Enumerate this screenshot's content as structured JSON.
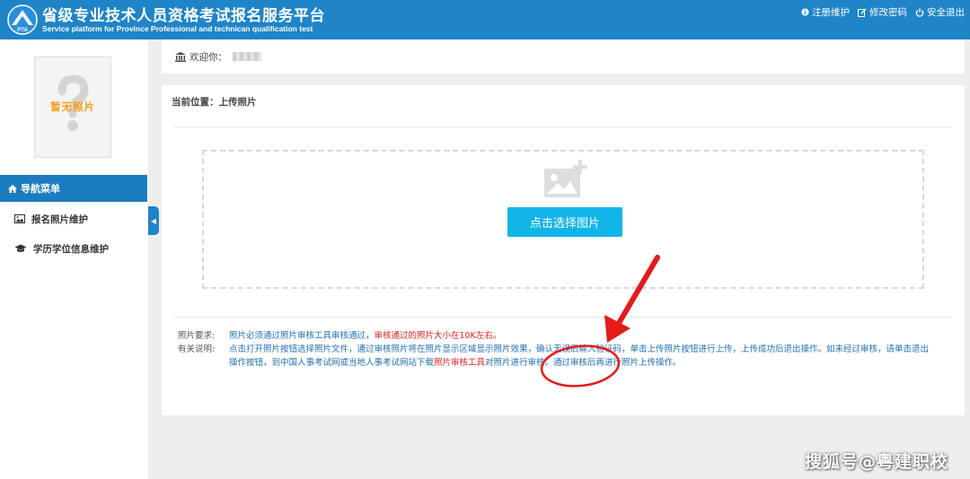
{
  "header": {
    "title_cn": "省级专业技术人员资格考试报名服务平台",
    "title_en": "Service platform for Province Professional and technican qualification test",
    "links": {
      "register": "注册维护",
      "change_password": "修改密码",
      "logout": "安全退出"
    },
    "color": "#1f84c8"
  },
  "sidebar": {
    "avatar_placeholder": "暂无照片",
    "nav_header": "导航菜单",
    "items": [
      {
        "label": "报名照片维护",
        "icon": "image-icon"
      },
      {
        "label": "学历学位信息维护",
        "icon": "graduation-cap-icon"
      }
    ]
  },
  "welcome": {
    "label": "欢迎你："
  },
  "main": {
    "breadcrumb": "当前位置：上传照片",
    "upload_button": "点击选择图片",
    "accent_color": "#12b5e8",
    "requirements_label": "照片要求:",
    "requirements_text": "照片必须通过照片审核工具审核通过，",
    "requirements_red": "审核通过的照片大小在10K左右。",
    "notes_label": "有关说明:",
    "notes_text_1": "点击打开照片按钮选择照片文件，通过审核照片将在照片显示区域显示照片效果，确认无误后输入验证码，单击上传照片按钮进行上传，上传成功后退出操作。如未经过审核，请单击退出操作按钮，到中国人事考试网或当地人事考试网站下载",
    "notes_red": "照片审核工具",
    "notes_text_2": "对照片进行审核。通过审核后再进行照片上传操作。"
  },
  "watermark": "搜狐号@粤建职校"
}
